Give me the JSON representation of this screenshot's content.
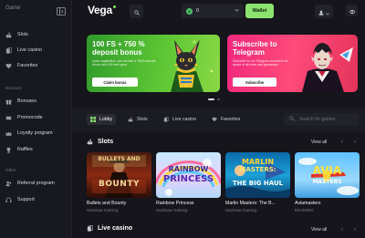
{
  "sidebar": {
    "menu_label": "Game",
    "items": [
      {
        "label": "Slots",
        "icon": "cherry-icon"
      },
      {
        "label": "Live casino",
        "icon": "cards-icon"
      },
      {
        "label": "Favorites",
        "icon": "heart-icon"
      }
    ],
    "bonuses_section": "Bonuses",
    "bonus_items": [
      {
        "label": "Bonuses",
        "icon": "gift-icon"
      },
      {
        "label": "Promocode",
        "icon": "ticket-icon"
      },
      {
        "label": "Loyalty program",
        "icon": "crown-icon"
      },
      {
        "label": "Raffles",
        "icon": "trophy-icon"
      }
    ],
    "other_section": "Other",
    "other_items": [
      {
        "label": "Referral program",
        "icon": "users-icon"
      },
      {
        "label": "Support",
        "icon": "headset-icon"
      }
    ]
  },
  "header": {
    "logo": "Vega",
    "balance": "0",
    "wallet_label": "Wallet"
  },
  "banners": [
    {
      "title": "100 FS + 750 % deposit bonus",
      "subtitle": "Upon registration, you receive a 750% deposit bonus and 100 free spins",
      "button": "Claim bonus"
    },
    {
      "title": "Subscribe to Telegram",
      "subtitle": "Subscribe to our Telegram channel to be aware of all news and giveaways",
      "button": "Subscribe"
    }
  ],
  "categories": {
    "tabs": [
      {
        "label": "Lobby",
        "icon": "grid-icon"
      },
      {
        "label": "Slots",
        "icon": "cherry-icon"
      },
      {
        "label": "Live casino",
        "icon": "cards-icon"
      },
      {
        "label": "Favorites",
        "icon": "heart-icon"
      }
    ],
    "search_placeholder": "Search for games"
  },
  "slots_section": {
    "title": "Slots",
    "view_all": "View all",
    "games": [
      {
        "name": "Bullets and Bounty",
        "provider": "Hacksaw Gaming",
        "art_text": "BULLETS AND BOUNTY"
      },
      {
        "name": "Rainbow Princess",
        "provider": "Hacksaw Gaming",
        "art_text": "RAINBOW PRINCESS"
      },
      {
        "name": "Marlin Masters: The B...",
        "provider": "Hacksaw Gaming",
        "art_text": "MARLIN MASTERS THE BIG HAUL"
      },
      {
        "name": "Aviamasters",
        "provider": "BGAMING",
        "art_text": "AVIA MASTERS"
      }
    ]
  },
  "live_section": {
    "title": "Live casino",
    "view_all": "View all"
  },
  "colors": {
    "accent": "#8be26f",
    "background": "#15151b",
    "sidebar": "#18181f",
    "banner_green": "#4fb532",
    "banner_pink": "#f0287d"
  }
}
